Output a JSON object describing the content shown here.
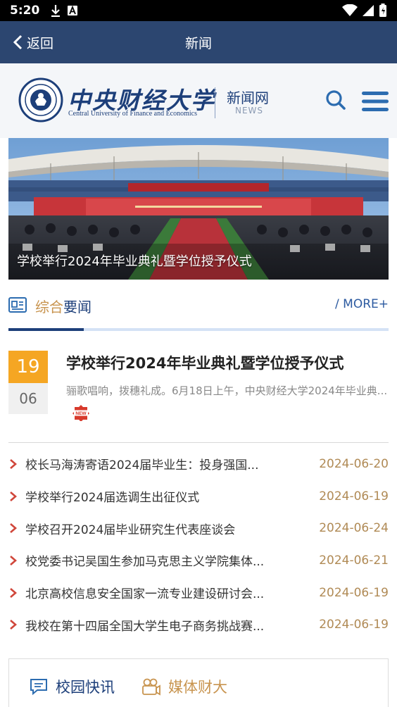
{
  "status_bar": {
    "time": "5:20"
  },
  "nav": {
    "back_label": "返回",
    "title": "新闻"
  },
  "header": {
    "logo_cn": "中央财经大学",
    "logo_en": "Central University of Finance and Economics",
    "site_name": "新闻网",
    "site_sub": "NEWS"
  },
  "banner": {
    "caption": "学校举行2024年毕业典礼暨学位授予仪式"
  },
  "section": {
    "title_highlight": "综合",
    "title_rest": "要闻",
    "more_label": "/   MORE+"
  },
  "featured": {
    "day": "19",
    "month": "06",
    "title": "学校举行2024年毕业典礼暨学位授予仪式",
    "summary": "骊歌唱响，拨穗礼成。6月18日上午，中央财经大学2024年毕业典..."
  },
  "news_list": [
    {
      "title": "校长马海涛寄语2024届毕业生：投身强国...",
      "date": "2024-06-20"
    },
    {
      "title": "学校举行2024届选调生出征仪式",
      "date": "2024-06-19"
    },
    {
      "title": "学校召开2024届毕业研究生代表座谈会",
      "date": "2024-06-24"
    },
    {
      "title": "校党委书记吴国生参加马克思主义学院集体...",
      "date": "2024-06-21"
    },
    {
      "title": "北京高校信息安全国家一流专业建设研讨会...",
      "date": "2024-06-19"
    },
    {
      "title": "我校在第十四届全国大学生电子商务挑战赛...",
      "date": "2024-06-19"
    }
  ],
  "bottom_tabs": {
    "campus": "校园快讯",
    "media": "媒体财大"
  },
  "colors": {
    "nav_bg": "#2c4670",
    "brand_blue": "#1d3f7a",
    "accent_gold": "#c8944f",
    "date_orange": "#f5a623"
  }
}
